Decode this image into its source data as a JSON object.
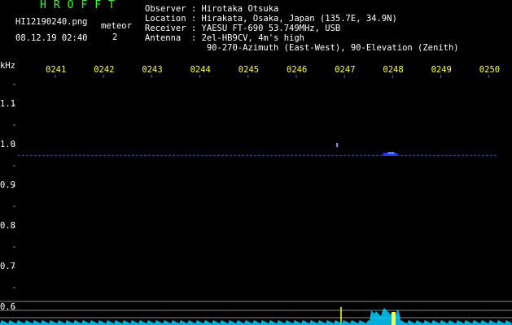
{
  "header": {
    "brand": "HROFFT",
    "filename": "HI12190240.png",
    "datetime": "08.12.19 02:40",
    "meteor_label": "meteor",
    "meteor_count": "2"
  },
  "station": {
    "observer_label": "Observer",
    "observer": "Hirotaka Otsuka",
    "location_label": "Location",
    "location": "Hirakata, Osaka, Japan (135.7E, 34.9N)",
    "receiver_label": "Receiver",
    "receiver": "YAESU FT-690 53.749MHz, USB",
    "antenna_label": "Antenna",
    "antenna": "2el-HB9CV, 4m's high",
    "antenna_direction": "90-270-Azimuth (East-West), 90-Elevation (Zenith)"
  },
  "chart_data": {
    "type": "heatmap",
    "ylabel": "kHz",
    "time_ticks": [
      "0241",
      "0242",
      "0243",
      "0244",
      "0245",
      "0246",
      "0247",
      "0248",
      "0249",
      "0250"
    ],
    "y_ticks": [
      "1.1",
      "1.0",
      "0.9",
      "0.8",
      "0.7",
      "0.6"
    ],
    "carrier_khz": 0.985,
    "echoes": [
      {
        "time": "0247",
        "khz": 1.0
      },
      {
        "time": "0248",
        "khz": 0.99
      }
    ]
  },
  "colors": {
    "background": "#000000",
    "title": "#33ff33",
    "time_axis": "#ffff33",
    "text": "#ffffff",
    "signal": "#3344cc",
    "spectrum": "#00ccff"
  }
}
